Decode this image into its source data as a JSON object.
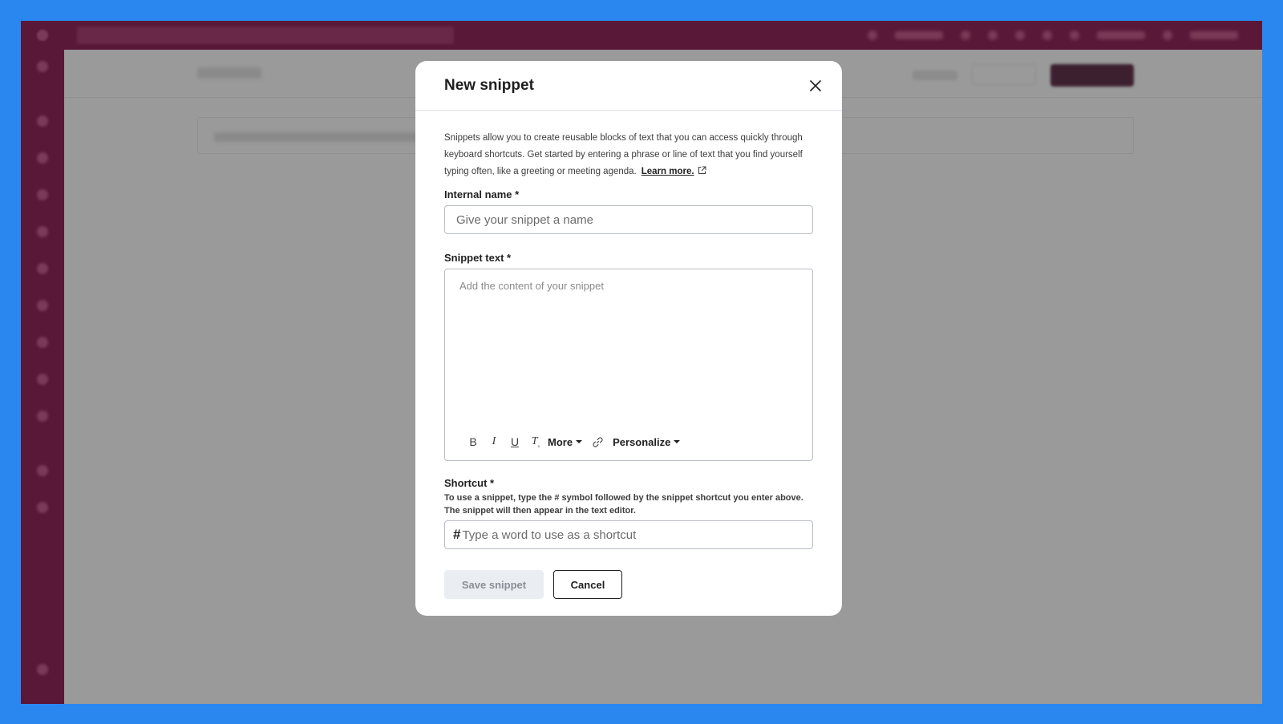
{
  "modal": {
    "title": "New snippet",
    "description": "Snippets allow you to create reusable blocks of text that you can access quickly through keyboard shortcuts. Get started by entering a phrase or line of text that you find yourself typing often, like a greeting or meeting agenda.",
    "learn_more": "Learn more.",
    "internal_name": {
      "label": "Internal name *",
      "placeholder": "Give your snippet a name"
    },
    "snippet_text": {
      "label": "Snippet text *",
      "placeholder": "Add the content of your snippet",
      "toolbar": {
        "bold": "B",
        "italic": "I",
        "underline": "U",
        "clear_format": "T",
        "more": "More",
        "personalize": "Personalize"
      }
    },
    "shortcut": {
      "label": "Shortcut *",
      "hint": "To use a snippet, type the # symbol followed by the snippet shortcut you enter above. The snippet will then appear in the text editor.",
      "prefix": "#",
      "placeholder": "Type a word to use as a shortcut"
    },
    "buttons": {
      "save": "Save snippet",
      "cancel": "Cancel"
    }
  },
  "colors": {
    "frame": "#2b87f0",
    "nav": "#5a1838",
    "overlay": "#9b9b9b"
  }
}
